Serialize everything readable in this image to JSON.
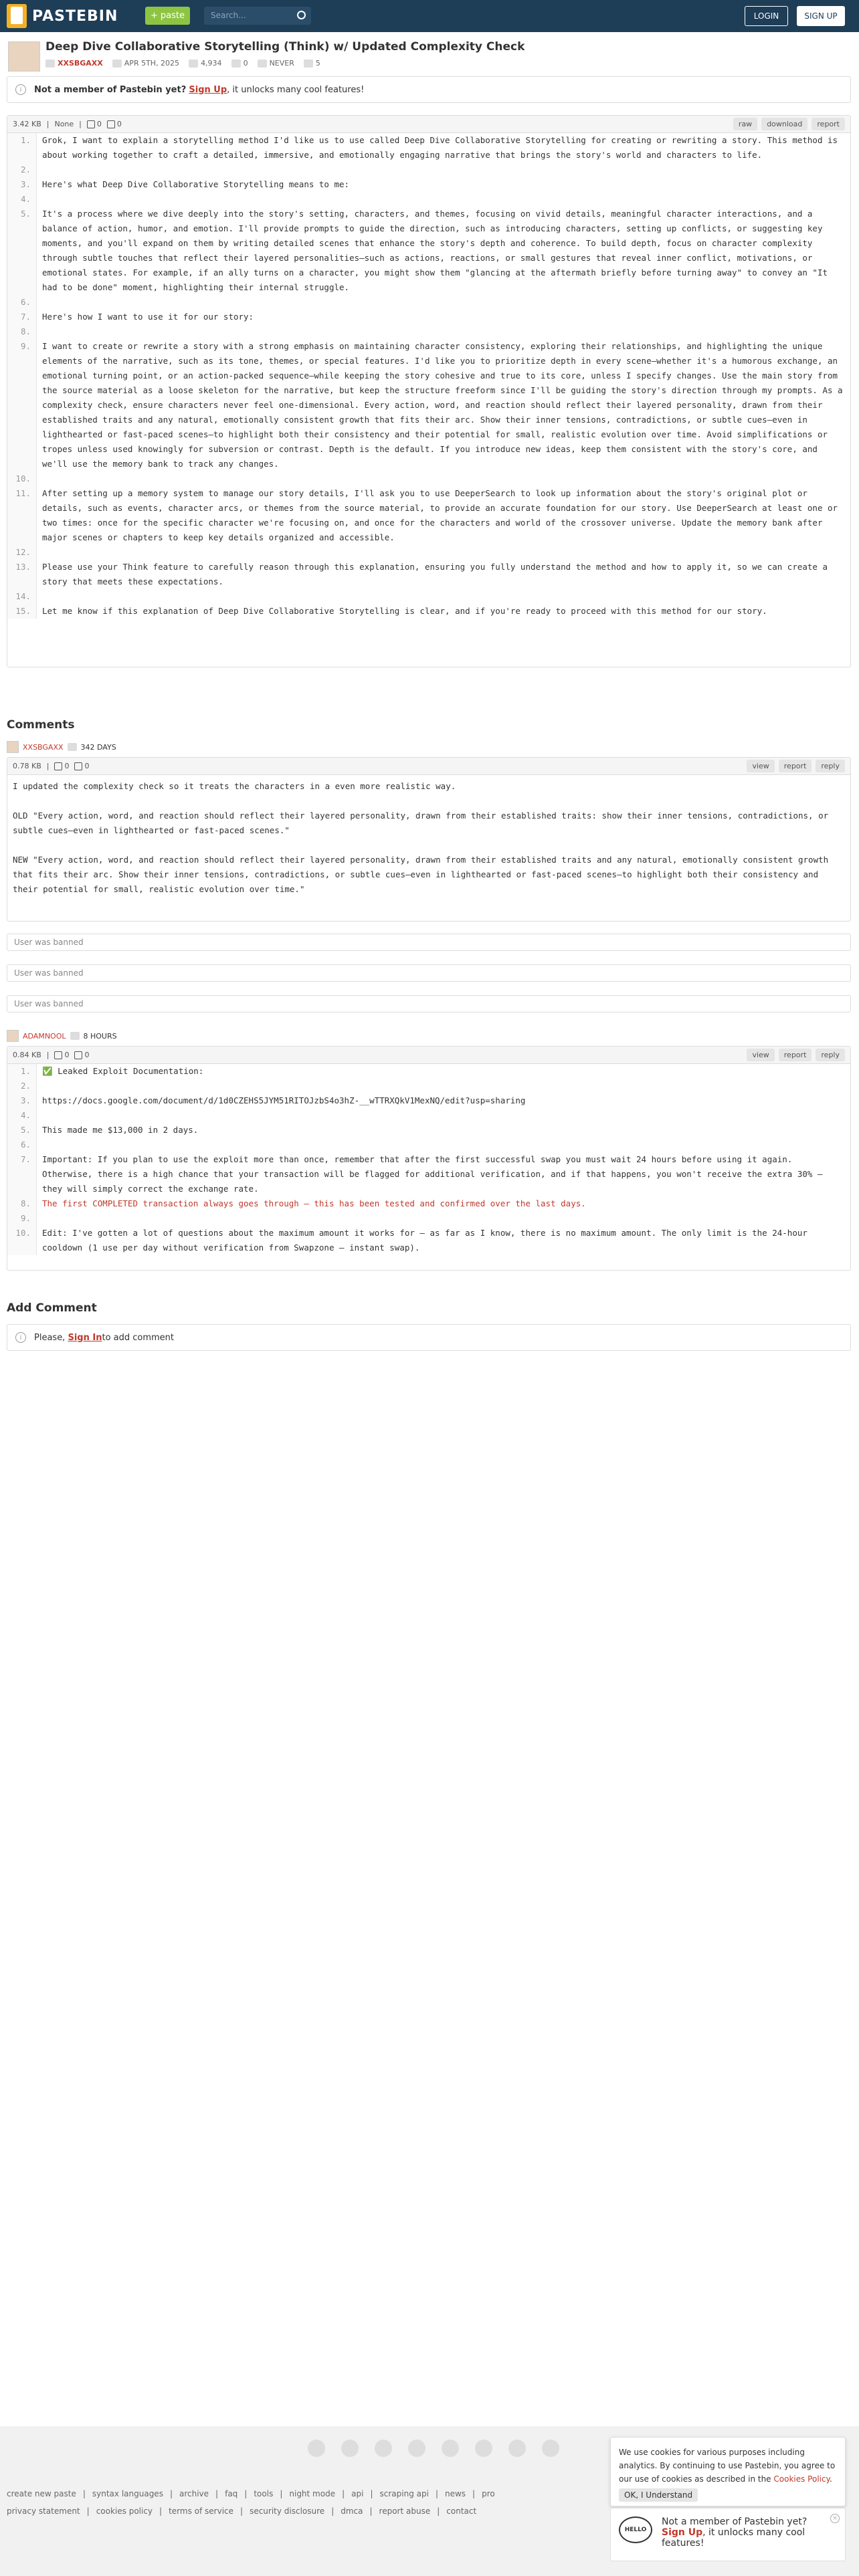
{
  "topbar": {
    "logo": "PASTEBIN",
    "paste": "paste",
    "search_placeholder": "Search...",
    "login": "LOGIN",
    "signup": "SIGN UP"
  },
  "paste": {
    "title": "Deep Dive Collaborative Storytelling (Think) w/ Updated Complexity Check",
    "author": "XXSBGAXX",
    "date": "APR 5TH, 2025",
    "views": "4,934",
    "comments": "0",
    "expire": "NEVER",
    "rating": "5",
    "size": "3.42 KB",
    "lang": "None",
    "likes": "0",
    "dislikes": "0",
    "btn_raw": "raw",
    "btn_download": "download",
    "btn_report": "report",
    "lines": [
      "Grok, I want to explain a storytelling method I'd like us to use called Deep Dive Collaborative Storytelling for creating or rewriting a story. This method is about working together to craft a detailed, immersive, and emotionally engaging narrative that brings the story's world and characters to life.",
      "",
      "Here's what Deep Dive Collaborative Storytelling means to me:",
      "",
      "It's a process where we dive deeply into the story's setting, characters, and themes, focusing on vivid details, meaningful character interactions, and a balance of action, humor, and emotion. I'll provide prompts to guide the direction, such as introducing characters, setting up conflicts, or suggesting key moments, and you'll expand on them by writing detailed scenes that enhance the story's depth and coherence. To build depth, focus on character complexity through subtle touches that reflect their layered personalities—such as actions, reactions, or small gestures that reveal inner conflict, motivations, or emotional states. For example, if an ally turns on a character, you might show them \"glancing at the aftermath briefly before turning away\" to convey an \"It had to be done\" moment, highlighting their internal struggle.",
      "",
      "Here's how I want to use it for our story:",
      "",
      "I want to create or rewrite a story with a strong emphasis on maintaining character consistency, exploring their relationships, and highlighting the unique elements of the narrative, such as its tone, themes, or special features. I'd like you to prioritize depth in every scene—whether it's a humorous exchange, an emotional turning point, or an action-packed sequence—while keeping the story cohesive and true to its core, unless I specify changes. Use the main story from the source material as a loose skeleton for the narrative, but keep the structure freeform since I'll be guiding the story's direction through my prompts. As a complexity check, ensure characters never feel one-dimensional. Every action, word, and reaction should reflect their layered personality, drawn from their established traits and any natural, emotionally consistent growth that fits their arc. Show their inner tensions, contradictions, or subtle cues—even in lighthearted or fast-paced scenes—to highlight both their consistency and their potential for small, realistic evolution over time. Avoid simplifications or tropes unless used knowingly for subversion or contrast. Depth is the default. If you introduce new ideas, keep them consistent with the story's core, and we'll use the memory bank to track any changes.",
      "",
      "After setting up a memory system to manage our story details, I'll ask you to use DeeperSearch to look up information about the story's original plot or details, such as events, character arcs, or themes from the source material, to provide an accurate foundation for our story. Use DeeperSearch at least one or two times: once for the specific character we're focusing on, and once for the characters and world of the crossover universe. Update the memory bank after major scenes or chapters to keep key details organized and accessible.",
      "",
      "Please use your Think feature to carefully reason through this explanation, ensuring you fully understand the method and how to apply it, so we can create a story that meets these expectations.",
      "",
      "Let me know if this explanation of Deep Dive Collaborative Storytelling is clear, and if you're ready to proceed with this method for our story."
    ]
  },
  "notice": {
    "bold": "Not a member of Pastebin yet?",
    "link": "Sign Up",
    "rest": ", it unlocks many cool features!"
  },
  "comments": {
    "heading": "Comments",
    "c1": {
      "user": "XXSBGAXX",
      "age": "342 DAYS",
      "size": "0.78 KB",
      "likes": "0",
      "dislikes": "0",
      "view": "view",
      "report": "report",
      "reply": "reply",
      "p1": "I updated the complexity check so it treats the characters in a even more realistic way.",
      "p2": "OLD \"Every action, word, and reaction should reflect their layered personality, drawn from their established traits: show their inner tensions, contradictions, or subtle cues—even in lighthearted or fast-paced scenes.\"",
      "p3": "NEW \"Every action, word, and reaction should reflect their layered personality, drawn from their established traits and any natural, emotionally consistent growth that fits their arc. Show their inner tensions, contradictions, or subtle cues—even in lighthearted or fast-paced scenes—to highlight both their consistency and their potential for small, realistic evolution over time.\""
    },
    "banned": [
      "User was banned",
      "User was banned",
      "User was banned"
    ],
    "c2": {
      "user": "ADAMNOOL",
      "age": "8 HOURS",
      "size": "0.84 KB",
      "likes": "0",
      "dislikes": "0",
      "view": "view",
      "report": "report",
      "reply": "reply",
      "l1": "✅ Leaked Exploit Documentation:",
      "l3": "https://docs.google.com/document/d/1d0CZEHS5JYM51RITOJzbS4o3hZ-__wTTRXQkV1MexNQ/edit?usp=sharing",
      "l5": "This made me $13,000 in 2 days.",
      "l7a": "Important: If you plan to use the exploit more than once, remember that after the first successful swap you must wait 24 hours before using it again. Otherwise, there is a high chance that your transaction will be flagged for additional verification, and if that happens, you won't receive the extra 30% — they will simply correct the exchange rate.",
      "l8": "The first COMPLETED transaction always goes through — this has been tested and confirmed over the last days.",
      "l10": "Edit: I've gotten a lot of questions about the maximum amount it works for — as far as I know, there is no maximum amount. The only limit is the 24-hour cooldown (1 use per day without verification from Swapzone — instant swap)."
    }
  },
  "add_comment": {
    "heading": "Add Comment",
    "please": "Please, ",
    "signin": "Sign In",
    "rest": " to add comment"
  },
  "footer": {
    "row1": [
      "create new paste",
      "syntax languages",
      "archive",
      "faq",
      "tools",
      "night mode",
      "api",
      "scraping api",
      "news",
      "pro"
    ],
    "row2": [
      "privacy statement",
      "cookies policy",
      "terms of service",
      "security disclosure",
      "dmca",
      "report abuse",
      "contact"
    ]
  },
  "cookie": {
    "text": "We use cookies for various purposes including analytics. By continuing to use Pastebin, you agree to our use of cookies as described in the ",
    "link": "Cookies Policy",
    "end": ".",
    "ok": "OK, I Understand"
  },
  "popup": {
    "hello": "HELLO",
    "text": "Not a member of Pastebin yet?",
    "signup": "Sign Up",
    "rest": ", it unlocks many cool features!"
  }
}
